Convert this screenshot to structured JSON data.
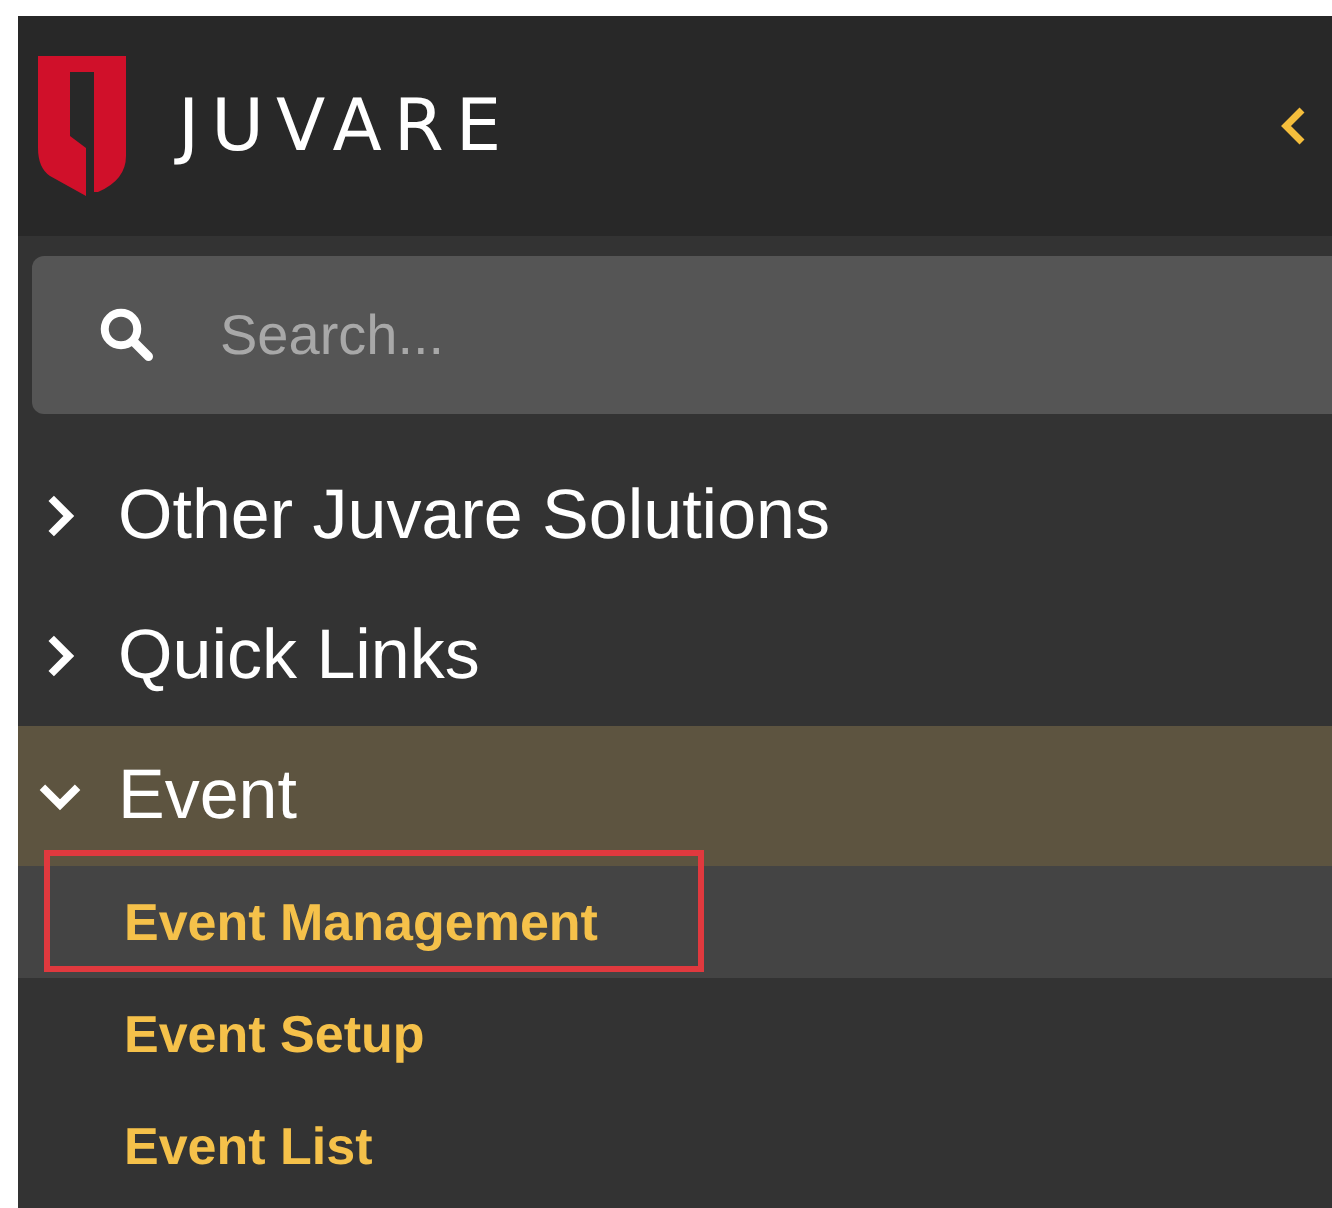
{
  "logo": {
    "text": "JUVARE"
  },
  "search": {
    "placeholder": "Search..."
  },
  "sections": [
    {
      "label": "Other Juvare Solutions",
      "expanded": false,
      "selected": false
    },
    {
      "label": "Quick Links",
      "expanded": false,
      "selected": false
    },
    {
      "label": "Event",
      "expanded": true,
      "selected": true,
      "children": [
        {
          "label": "Event Management",
          "selected": true,
          "highlighted": true
        },
        {
          "label": "Event Setup",
          "selected": false,
          "highlighted": false
        },
        {
          "label": "Event List",
          "selected": false,
          "highlighted": false
        }
      ]
    }
  ]
}
